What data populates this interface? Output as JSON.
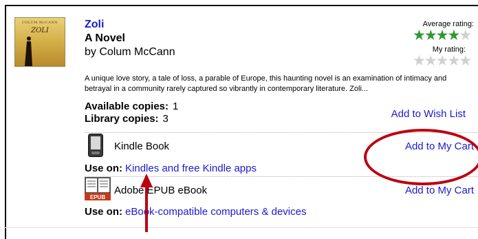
{
  "book": {
    "cover": {
      "author": "COLUM McCANN",
      "title": "ZOLI"
    },
    "title": "Zoli",
    "subtitle": "A Novel",
    "byline": "by Colum McCann",
    "description": "A unique love story, a tale of loss, a parable of Europe, this haunting novel is an examination of intimacy and betrayal in a community rarely captured so vibrantly in contemporary literature. Zoli..."
  },
  "ratings": {
    "average_label": "Average rating:",
    "average_stars": 4,
    "my_label": "My rating:",
    "my_stars": 0,
    "max_stars": 5
  },
  "availability": {
    "available_label": "Available copies:",
    "available_value": "1",
    "library_label": "Library copies:",
    "library_value": "3",
    "wish_label": "Add to Wish List"
  },
  "formats": [
    {
      "icon": "kindle-icon",
      "name": "Kindle Book",
      "cart_label": "Add to My Cart",
      "use_label": "Use on:",
      "use_value": "Kindles and free Kindle apps"
    },
    {
      "icon": "epub-icon",
      "icon_text": "EPUB",
      "name": "Adobe EPUB eBook",
      "cart_label": "Add to My Cart",
      "use_label": "Use on:",
      "use_value": "eBook-compatible computers & devices"
    }
  ],
  "colors": {
    "link": "#1a1acc",
    "star_on": "#2e9a2e",
    "star_off": "#d0d0d0",
    "annotation": "#bb0010"
  }
}
